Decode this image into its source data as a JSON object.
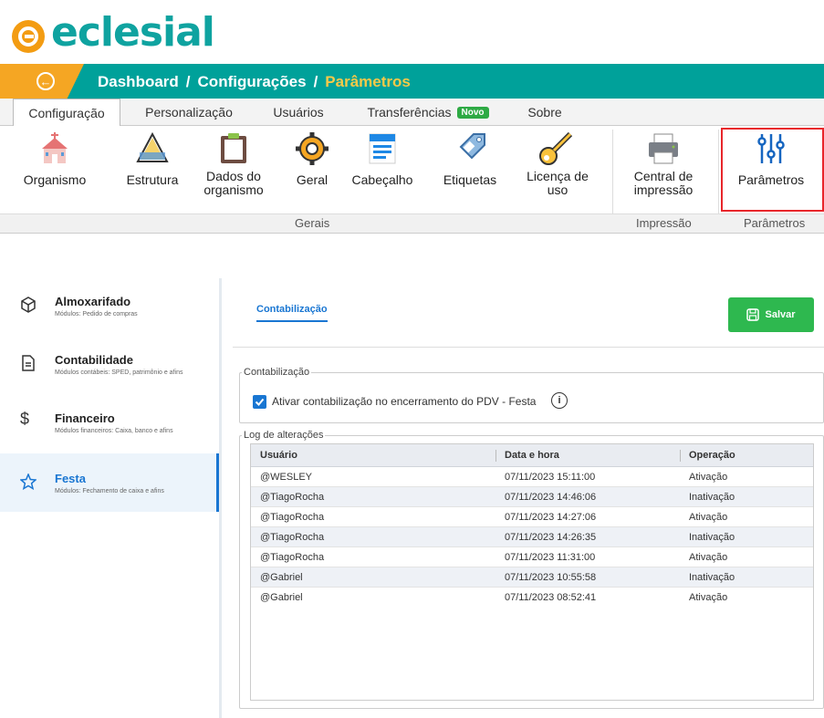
{
  "app": {
    "name": "eclesial"
  },
  "breadcrumb": {
    "items": [
      "Dashboard",
      "/",
      "Configurações",
      "/"
    ],
    "current": "Parâmetros"
  },
  "tabs": [
    {
      "label": "Configuração"
    },
    {
      "label": "Personalização"
    },
    {
      "label": "Usuários"
    },
    {
      "label": "Transferências",
      "badge": "Novo"
    },
    {
      "label": "Sobre"
    }
  ],
  "ribbon": {
    "buttons": [
      "Organismo",
      "Estrutura",
      "Dados do organismo",
      "Geral",
      "Cabeçalho",
      "Etiquetas",
      "Licença de uso",
      "Central de impressão",
      "Parâmetros"
    ],
    "groups": [
      "Gerais",
      "Impressão",
      "Parâmetros"
    ]
  },
  "sidebar": [
    {
      "title": "Almoxarifado",
      "desc": "Módulos: Pedido de compras",
      "icon": "box-icon"
    },
    {
      "title": "Contabilidade",
      "desc": "Módulos contábeis: SPED, patrimônio e afins",
      "icon": "document-icon"
    },
    {
      "title": "Financeiro",
      "desc": "Módulos financeiros: Caixa, banco e afins",
      "icon": "dollar-icon"
    },
    {
      "title": "Festa",
      "desc": "Módulos: Fechamento de caixa e afins",
      "icon": "star-icon"
    }
  ],
  "main": {
    "subtab": "Contabilização",
    "save_label": "Salvar",
    "section1": {
      "legend": "Contabilização",
      "checkbox_label": "Ativar contabilização no encerramento do PDV - Festa",
      "checked": true
    },
    "log": {
      "legend": "Log de alterações",
      "columns": [
        "Usuário",
        "Data e hora",
        "Operação"
      ],
      "rows": [
        [
          "@WESLEY",
          "07/11/2023 15:11:00",
          "Ativação"
        ],
        [
          "@TiagoRocha",
          "07/11/2023 14:46:06",
          "Inativação"
        ],
        [
          "@TiagoRocha",
          "07/11/2023 14:27:06",
          "Ativação"
        ],
        [
          "@TiagoRocha",
          "07/11/2023 14:26:35",
          "Inativação"
        ],
        [
          "@TiagoRocha",
          "07/11/2023 11:31:00",
          "Ativação"
        ],
        [
          "@Gabriel",
          "07/11/2023 10:55:58",
          "Inativação"
        ],
        [
          "@Gabriel",
          "07/11/2023 08:52:41",
          "Ativação"
        ]
      ]
    }
  },
  "colors": {
    "teal": "#00a19a",
    "orange": "#f5a623",
    "accent": "#1976d2",
    "save": "#2eb84f",
    "highlight": "#e8262b"
  }
}
